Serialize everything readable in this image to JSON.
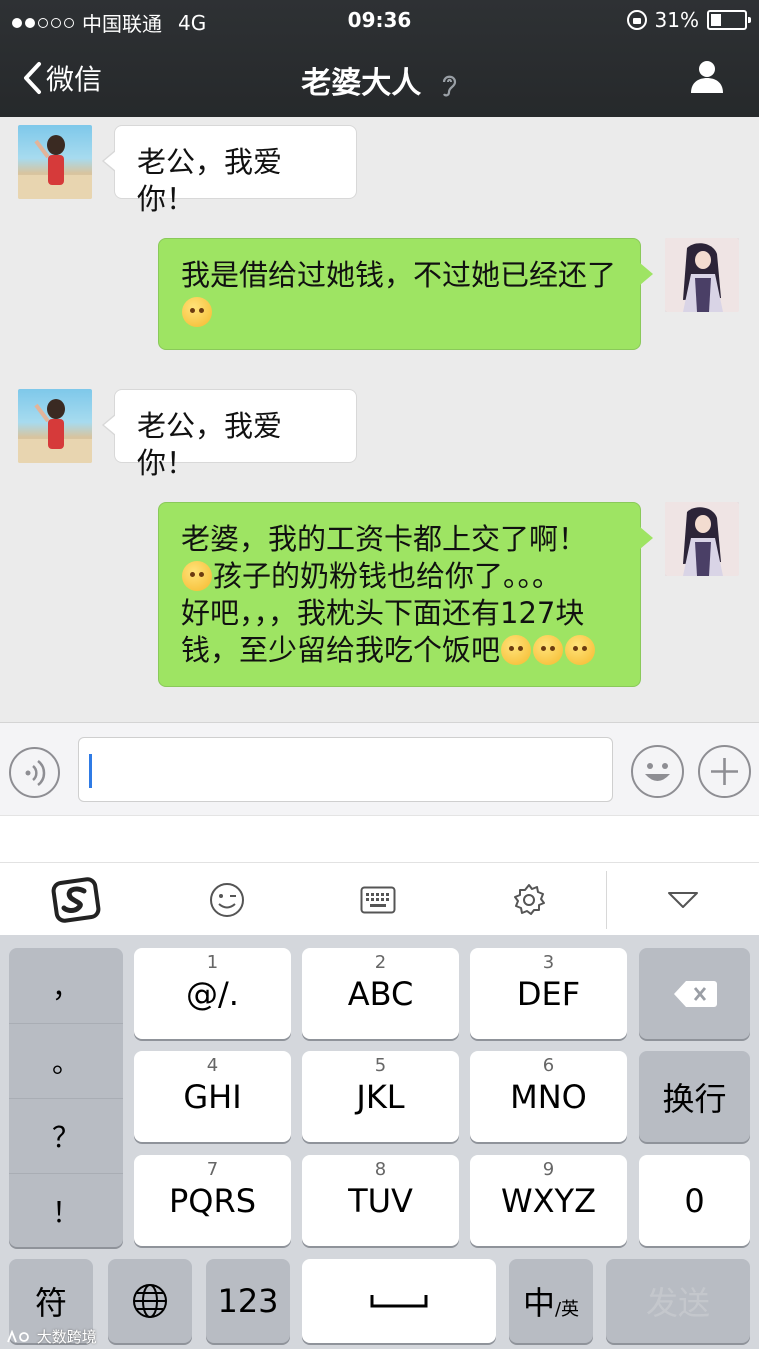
{
  "status": {
    "carrier": "中国联通",
    "network": "4G",
    "time": "09:36",
    "battery": "31%",
    "battery_level": 0.31,
    "signal_bars": 2,
    "signal_total": 5
  },
  "nav": {
    "back_label": "微信",
    "title": "老婆大人"
  },
  "messages": [
    {
      "side": "in",
      "text": "老公，我爱你！"
    },
    {
      "side": "out",
      "text": "我是借给过她钱，不过她已经还了"
    },
    {
      "side": "in",
      "text": "老公，我爱你！"
    },
    {
      "side": "out",
      "line1": "老婆，我的工资卡都上交了啊！",
      "line2": "孩子的奶粉钱也给你了。。。",
      "line3": "好吧，，，我枕头下面还有127块",
      "line4": "钱，至少留给我吃个饭吧"
    }
  ],
  "keyboard": {
    "punct": [
      "，",
      "。",
      "？",
      "！"
    ],
    "keys": [
      {
        "num": "1",
        "label": "@/."
      },
      {
        "num": "2",
        "label": "ABC"
      },
      {
        "num": "3",
        "label": "DEF"
      },
      {
        "num": "4",
        "label": "GHI"
      },
      {
        "num": "5",
        "label": "JKL"
      },
      {
        "num": "6",
        "label": "MNO"
      },
      {
        "num": "7",
        "label": "PQRS"
      },
      {
        "num": "8",
        "label": "TUV"
      },
      {
        "num": "9",
        "label": "WXYZ"
      }
    ],
    "newline": "换行",
    "zero": "0",
    "symbol": "符",
    "numbers": "123",
    "lang_main": "中",
    "lang_sub": "/英",
    "send": "发送"
  },
  "watermark": "大数跨境",
  "colors": {
    "nav_bg": "#2b2e30",
    "bubble_out": "#9ee463",
    "bubble_in": "#ffffff",
    "chat_bg": "#ebebeb",
    "caret": "#2f7be5"
  },
  "icons": [
    "back-chevron-icon",
    "ear-icon",
    "profile-icon",
    "voice-icon",
    "emoji-icon",
    "plus-icon",
    "sogou-logo-icon",
    "wink-emoji-icon",
    "keyboard-icon",
    "settings-gear-icon",
    "collapse-triangle-icon",
    "backspace-icon",
    "globe-icon"
  ]
}
